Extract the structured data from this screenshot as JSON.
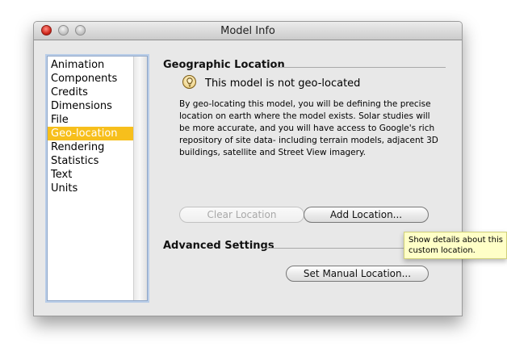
{
  "window": {
    "title": "Model Info"
  },
  "sidebar": {
    "items": [
      {
        "label": "Animation"
      },
      {
        "label": "Components"
      },
      {
        "label": "Credits"
      },
      {
        "label": "Dimensions"
      },
      {
        "label": "File"
      },
      {
        "label": "Geo-location",
        "selected": true
      },
      {
        "label": "Rendering"
      },
      {
        "label": "Statistics"
      },
      {
        "label": "Text"
      },
      {
        "label": "Units"
      }
    ]
  },
  "geographic": {
    "section_title": "Geographic Location",
    "status": "This model is not geo-located",
    "description": "By geo-locating this model, you will be defining the precise location on earth where the model exists. Solar studies will be more accurate, and you will have access to Google's rich repository of site data- including terrain models, adjacent 3D buildings, satellite and Street View imagery.",
    "clear_label": "Clear Location",
    "add_label": "Add Location..."
  },
  "advanced": {
    "section_title": "Advanced Settings",
    "manual_label": "Set Manual Location..."
  },
  "tooltip": {
    "line1": "Show details about this",
    "line2": "custom location."
  },
  "colors": {
    "selection": "#f7bf1c",
    "tooltip_bg": "#ffffc7"
  },
  "icons": {
    "status": "lightbulb-icon"
  }
}
